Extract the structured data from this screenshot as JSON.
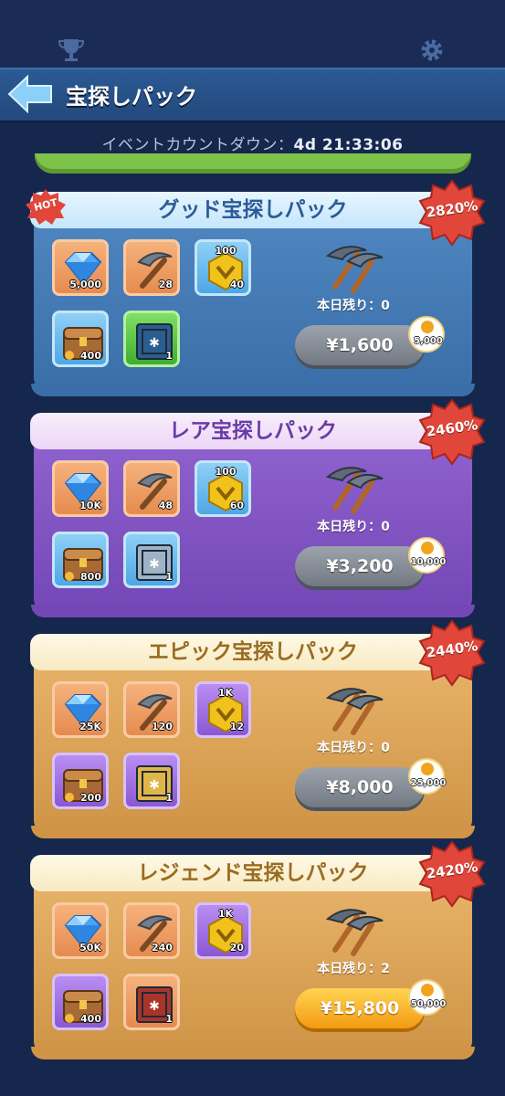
{
  "header": {
    "title": "宝探しパック",
    "countdown_label": "イベントカウントダウン：",
    "countdown_time": "4d 21:33:06"
  },
  "colors": {
    "header_blue": "#2b5a94",
    "badge_red": "#e0463a",
    "buy_grey": "#868c96",
    "buy_gold": "#f5b021"
  },
  "hot_label": "HOT",
  "packs": [
    {
      "title": "グッド宝探しパック",
      "bonus_percent": "2820%",
      "items": [
        {
          "icon": "diamond-icon",
          "qty": "5,000"
        },
        {
          "icon": "pickaxe-icon",
          "qty": "28"
        },
        {
          "icon": "gold-token-icon",
          "top": "100",
          "qty": "40"
        },
        {
          "icon": "treasure-chest-icon",
          "qty": "400"
        },
        {
          "icon": "blue-crate-icon",
          "qty": "1"
        }
      ],
      "remaining": "本日残り：0",
      "price": "¥1,600",
      "bonus_amount": "5,000"
    },
    {
      "title": "レア宝探しパック",
      "bonus_percent": "2460%",
      "items": [
        {
          "icon": "diamond-icon",
          "qty": "10K"
        },
        {
          "icon": "pickaxe-icon",
          "qty": "48"
        },
        {
          "icon": "gold-token-icon",
          "top": "100",
          "qty": "60"
        },
        {
          "icon": "treasure-chest-icon",
          "qty": "800"
        },
        {
          "icon": "silver-crate-icon",
          "qty": "1"
        }
      ],
      "remaining": "本日残り：0",
      "price": "¥3,200",
      "bonus_amount": "10,000"
    },
    {
      "title": "エピック宝探しパック",
      "bonus_percent": "2440%",
      "items": [
        {
          "icon": "diamond-icon",
          "qty": "25K"
        },
        {
          "icon": "pickaxe-icon",
          "qty": "120"
        },
        {
          "icon": "gold-token-icon",
          "top": "1K",
          "qty": "12"
        },
        {
          "icon": "treasure-chest-icon",
          "qty": "200"
        },
        {
          "icon": "gold-crate-icon",
          "qty": "1"
        }
      ],
      "remaining": "本日残り：0",
      "price": "¥8,000",
      "bonus_amount": "25,000"
    },
    {
      "title": "レジェンド宝探しパック",
      "bonus_percent": "2420%",
      "items": [
        {
          "icon": "diamond-icon",
          "qty": "50K"
        },
        {
          "icon": "pickaxe-icon",
          "qty": "240"
        },
        {
          "icon": "gold-token-icon",
          "top": "1K",
          "qty": "20"
        },
        {
          "icon": "treasure-chest-icon",
          "qty": "400"
        },
        {
          "icon": "red-crate-icon",
          "qty": "1"
        }
      ],
      "remaining": "本日残り：2",
      "price": "¥15,800",
      "bonus_amount": "50,000"
    }
  ]
}
